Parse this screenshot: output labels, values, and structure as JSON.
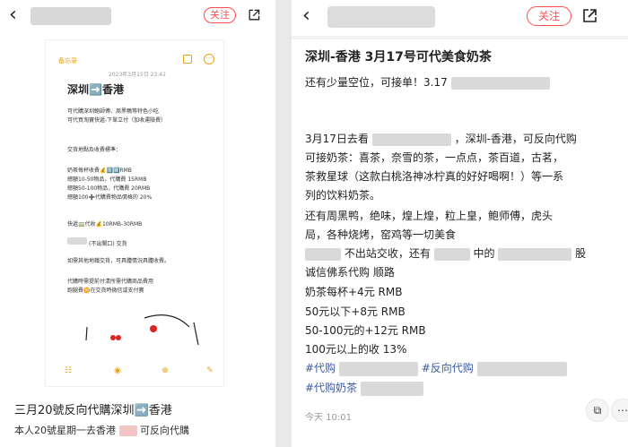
{
  "left": {
    "follow_label": "关注",
    "note": {
      "back_label": "备忘录",
      "date": "2023年3月15日 23:42",
      "title": "深圳➡️香港",
      "lines": [
        "可代購深圳鮑師傅、周黑鴨等特色小吃",
        "可代買淘寶快遞-下單立付（加收運險費）",
        "交貨地點及收費標準：",
        "奶茶每杯收費💰1️⃣0️⃣RMB",
        "總額10-50物品，代購費 15RMB",
        "總額50-100物品，代購費 20RMB",
        "總額100➕代購費物品價格的 20%",
        "快遞🚃代收💰10RMB-30RMB",
        "(不出閘口) 交貨",
        "如需其他地鐵交貨，可具體情況具體收費。",
        "代購時需提前付清所需代購商品費用",
        "跑腿費🉑在交貨時微信或支付寶"
      ]
    },
    "post_title": "三月20號反向代購深圳➡️香港",
    "post_sub_prefix": "本人20號星期一去香港",
    "post_sub_suffix": "可反向代購"
  },
  "right": {
    "follow_label": "关注",
    "title": "深圳-香港 3月17号可代美食奶茶",
    "line1": "还有少量空位，可接单！3.17",
    "line2a": "3月17日去看",
    "line2b": "，深圳-香港，可反向代购",
    "line3": "可接奶茶：喜茶，奈雪的茶，一点点，茶百道，古茗，",
    "line4": "茶救星球（这款白桃洛神冰柠真的好好喝啊！）等一系",
    "line5": "列的饮料奶茶。",
    "line6": "还有周黑鸭，绝味，煌上煌，粒上皇，鲍师傅，虎头",
    "line7": "局，各种烧烤，窑鸡等一切美食",
    "line8a": "不出站交收，还有",
    "line8b": "中的",
    "line8c": "股",
    "line9": "诚信佛系代购 顺路",
    "line10": "奶茶每杯+4元 RMB",
    "line11": "50元以下+8元 RMB",
    "line12": "50-100元的+12元 RMB",
    "line13": "100元以上的收 13%",
    "tag1": "#代购",
    "tag2": "#反向代购",
    "tag3": "#代购奶茶",
    "time": "今天 10:01"
  }
}
